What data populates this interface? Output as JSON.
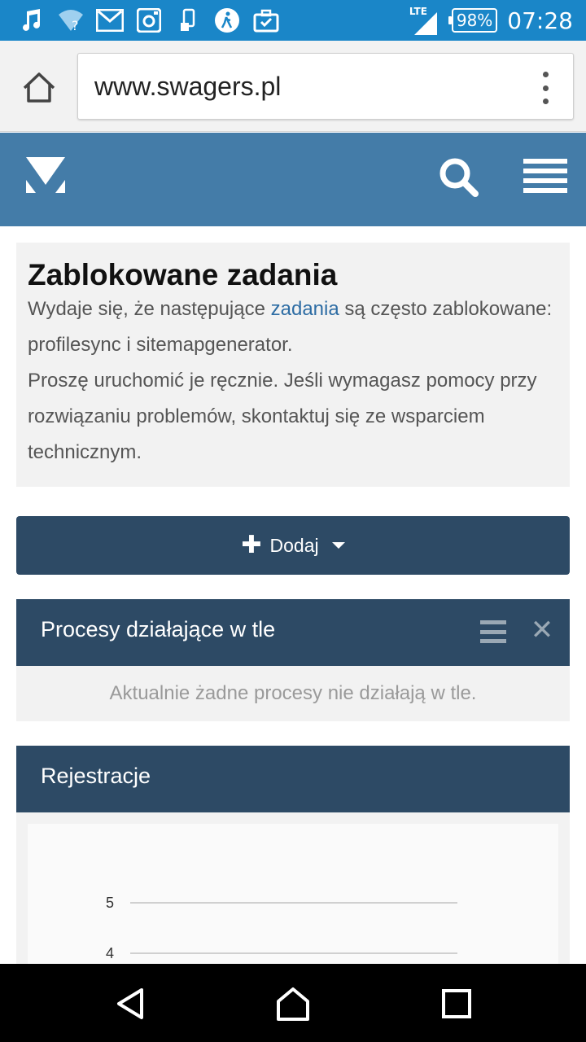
{
  "status_bar": {
    "left_icons": [
      "music-note-icon",
      "wifi-question-icon",
      "gmail-icon",
      "instagram-icon",
      "phone-transfer-icon",
      "walking-icon",
      "briefcase-check-icon"
    ],
    "network": "LTE",
    "battery": "98%",
    "time": "07:28"
  },
  "browser": {
    "url": "www.swagers.pl"
  },
  "alert": {
    "title": "Zablokowane zadania",
    "text_before_link": "Wydaje się, że następujące ",
    "link": "zadania",
    "text_after_link": " są często zablokowane: profilesync i sitemapgenerator.",
    "text_line2": "Proszę uruchomić je ręcznie. Jeśli wymagasz pomocy przy rozwiązaniu problemów, skontaktuj się ze wsparciem technicznym."
  },
  "add_button": {
    "label": "Dodaj"
  },
  "background_panel": {
    "title": "Procesy działające w tle",
    "message": "Aktualnie żadne procesy nie działają w tle."
  },
  "registrations_panel": {
    "title": "Rejestracje"
  },
  "chart_data": {
    "type": "line",
    "y_ticks": [
      "5",
      "4"
    ]
  },
  "colors": {
    "status_bar": "#1a86c8",
    "site_header": "#447ca8",
    "panel_header": "#2d4a65",
    "link": "#2e6da4"
  }
}
